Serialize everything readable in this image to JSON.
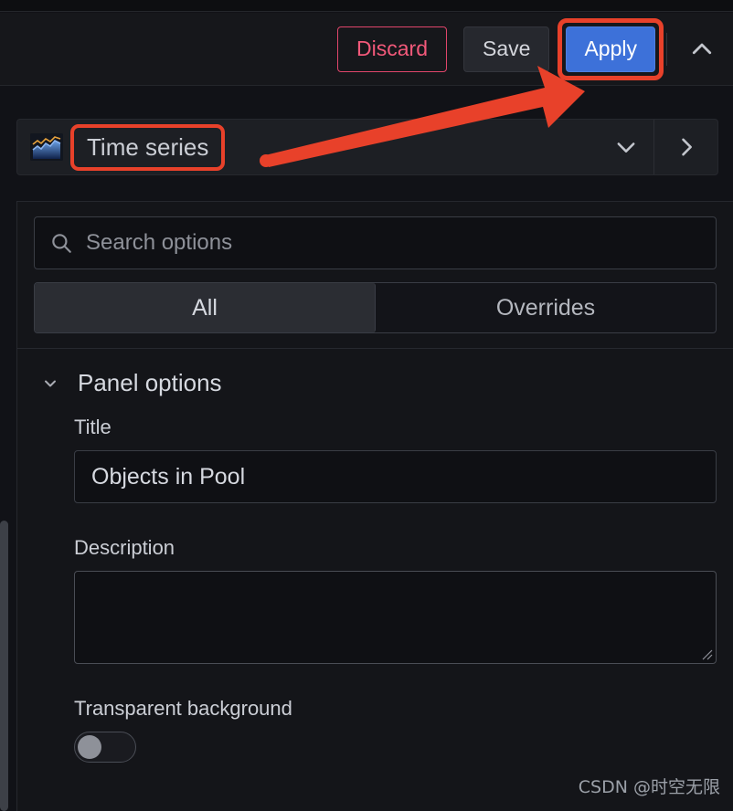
{
  "toolbar": {
    "discard_label": "Discard",
    "save_label": "Save",
    "apply_label": "Apply",
    "collapse_icon": "chevron-up-icon"
  },
  "visualization": {
    "icon": "time-series-chart-icon",
    "label": "Time series",
    "dropdown_icon": "chevron-down-icon",
    "next_icon": "chevron-right-icon"
  },
  "search": {
    "icon": "search-icon",
    "placeholder": "Search options",
    "value": ""
  },
  "tabs": [
    {
      "label": "All",
      "active": true
    },
    {
      "label": "Overrides",
      "active": false
    }
  ],
  "panel_options": {
    "section_title": "Panel options",
    "caret_icon": "chevron-down-icon",
    "title": {
      "label": "Title",
      "value": "Objects in Pool"
    },
    "description": {
      "label": "Description",
      "value": ""
    },
    "transparent_background": {
      "label": "Transparent background",
      "enabled": false
    }
  },
  "annotation": {
    "arrow_color": "#e8412a",
    "highlight_color": "#e8412a",
    "targets": [
      "Apply",
      "Time series"
    ]
  },
  "colors": {
    "accent_blue": "#3d71d9",
    "danger_pink": "#f2597a",
    "annotation_red": "#e8412a",
    "bg_dark": "#111217",
    "panel_bg": "#141519"
  },
  "watermark": "CSDN @时空无限"
}
